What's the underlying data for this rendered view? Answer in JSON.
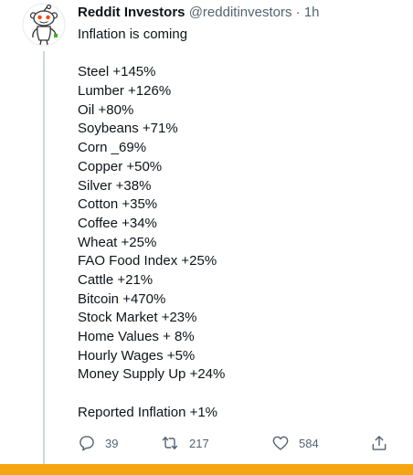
{
  "tweet": {
    "author_name": "Reddit Investors",
    "handle": "@redditinvestors",
    "separator": "·",
    "time": "1h",
    "intro": "Inflation is coming",
    "items": [
      "Steel +145%",
      "Lumber +126%",
      "Oil +80%",
      "Soybeans +71%",
      "Corn _69%",
      "Copper +50%",
      "Silver +38%",
      "Cotton +35%",
      "Coffee +34%",
      "Wheat +25%",
      "FAO Food Index +25%",
      "Cattle +21%",
      "Bitcoin +470%",
      "Stock Market +23%",
      "Home Values + 8%",
      "Hourly Wages +5%",
      "Money Supply Up +24%"
    ],
    "footer": "Reported Inflation +1%"
  },
  "actions": {
    "reply_icon": "reply-icon",
    "reply_count": "39",
    "retweet_icon": "retweet-icon",
    "retweet_count": "217",
    "like_icon": "heart-icon",
    "like_count": "584",
    "share_icon": "share-icon"
  },
  "colors": {
    "text": "#0f1419",
    "secondary": "#536471",
    "thread_line": "#cfd9de",
    "accent_bar": "#f5a511",
    "avatar_orange": "#ff4500"
  }
}
